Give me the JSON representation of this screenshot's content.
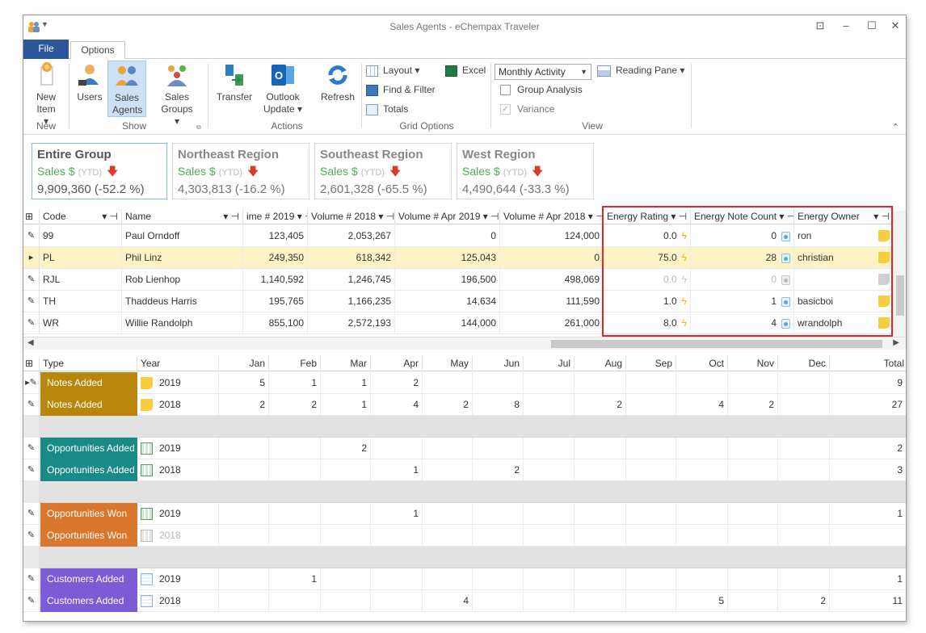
{
  "window": {
    "title": "Sales Agents - eChempax Traveler",
    "controls": [
      "⊡",
      "–",
      "☐",
      "✕"
    ]
  },
  "tabs": {
    "file": "File",
    "options": "Options"
  },
  "ribbon": {
    "new_item": "New Item ▾",
    "new_group": "New",
    "users": "Users",
    "sales_agents": "Sales Agents",
    "sales_groups": "Sales Groups ▾",
    "show_group": "Show",
    "transfer": "Transfer",
    "outlook_update": "Outlook Update ▾",
    "refresh": "Refresh",
    "actions_group": "Actions",
    "layout": "Layout ▾",
    "excel": "Excel",
    "find_filter": "Find & Filter",
    "totals": "Totals",
    "grid_options_group": "Grid Options",
    "activity_dropdown": "Monthly Activity",
    "group_analysis": "Group Analysis",
    "variance": "Variance",
    "reading_pane": "Reading Pane ▾",
    "view_group": "View"
  },
  "kpis": [
    {
      "title": "Entire Group",
      "metric": "Sales $",
      "ytd": "(YTD)",
      "value": "9,909,360 (-52.2 %)"
    },
    {
      "title": "Northeast Region",
      "metric": "Sales $",
      "ytd": "(YTD)",
      "value": "4,303,813 (-16.2 %)"
    },
    {
      "title": "Southeast Region",
      "metric": "Sales $",
      "ytd": "(YTD)",
      "value": "2,601,328 (-65.5 %)"
    },
    {
      "title": "West Region",
      "metric": "Sales $",
      "ytd": "(YTD)",
      "value": "4,490,644 (-33.3 %)"
    }
  ],
  "agents_grid": {
    "headers": {
      "code": "Code",
      "name": "Name",
      "vol_2019": "ime # 2019 ▾ ⊣",
      "vol_2018": "Volume # 2018 ▾ ⊣",
      "vol_apr_2019": "Volume # Apr 2019 ▾ ⊣",
      "vol_apr_2018": "Volume # Apr 2018 ▾ ⊣",
      "energy_rating": "Energy Rating ▾ ⊣",
      "energy_note_count": "Energy Note Count ▾ ⊣",
      "energy_owner": "Energy Owner"
    },
    "rows": [
      {
        "indicator": "✎",
        "code": "99",
        "name": "Paul Orndoff",
        "vol_2019": "123,405",
        "vol_2018": "2,053,267",
        "vol_apr_2019": "0",
        "vol_apr_2018": "124,000",
        "energy_rating": "0.0",
        "note_count": "0",
        "owner": "ron"
      },
      {
        "indicator": "▸",
        "code": "PL",
        "name": "Phil Linz",
        "vol_2019": "249,350",
        "vol_2018": "618,342",
        "vol_apr_2019": "125,043",
        "vol_apr_2018": "0",
        "energy_rating": "75.0",
        "note_count": "28",
        "owner": "christian"
      },
      {
        "indicator": "✎",
        "code": "RJL",
        "name": "Rob Lienhop",
        "vol_2019": "1,140,592",
        "vol_2018": "1,246,745",
        "vol_apr_2019": "196,500",
        "vol_apr_2018": "498,069",
        "energy_rating": "0.0",
        "note_count": "0",
        "owner": ""
      },
      {
        "indicator": "✎",
        "code": "TH",
        "name": "Thaddeus Harris",
        "vol_2019": "195,765",
        "vol_2018": "1,166,235",
        "vol_apr_2019": "14,634",
        "vol_apr_2018": "111,590",
        "energy_rating": "1.0",
        "note_count": "1",
        "owner": "basicboi"
      },
      {
        "indicator": "✎",
        "code": "WR",
        "name": "Willie Randolph",
        "vol_2019": "855,100",
        "vol_2018": "2,572,193",
        "vol_apr_2019": "144,000",
        "vol_apr_2018": "261,000",
        "energy_rating": "8.0",
        "note_count": "4",
        "owner": "wrandolph"
      }
    ]
  },
  "activity_grid": {
    "headers": {
      "type": "Type",
      "year": "Year",
      "months": [
        "Jan",
        "Feb",
        "Mar",
        "Apr",
        "May",
        "Jun",
        "Jul",
        "Aug",
        "Sep",
        "Oct",
        "Nov",
        "Dec"
      ],
      "total": "Total"
    },
    "groups": [
      {
        "type": "Notes Added",
        "color": "#b8860b",
        "rows": [
          {
            "year": "2019",
            "months": [
              "5",
              "1",
              "1",
              "2",
              "",
              "",
              "",
              "",
              "",
              "",
              "",
              ""
            ],
            "total": "9"
          },
          {
            "year": "2018",
            "months": [
              "2",
              "2",
              "1",
              "4",
              "2",
              "8",
              "",
              "2",
              "",
              "4",
              "2",
              ""
            ],
            "total": "27"
          }
        ]
      },
      {
        "type": "Opportunities Added",
        "color": "#1a8a88",
        "rows": [
          {
            "year": "2019",
            "months": [
              "",
              "",
              "2",
              "",
              "",
              "",
              "",
              "",
              "",
              "",
              "",
              ""
            ],
            "total": "2"
          },
          {
            "year": "2018",
            "months": [
              "",
              "",
              "",
              "1",
              "",
              "2",
              "",
              "",
              "",
              "",
              "",
              ""
            ],
            "total": "3"
          }
        ]
      },
      {
        "type": "Opportunities Won",
        "color": "#d9782d",
        "rows": [
          {
            "year": "2019",
            "months": [
              "",
              "",
              "",
              "1",
              "",
              "",
              "",
              "",
              "",
              "",
              "",
              ""
            ],
            "total": "1"
          },
          {
            "year": "2018",
            "months": [
              "",
              "",
              "",
              "",
              "",
              "",
              "",
              "",
              "",
              "",
              "",
              ""
            ],
            "total": ""
          }
        ]
      },
      {
        "type": "Customers Added",
        "color": "#7b5bd6",
        "rows": [
          {
            "year": "2019",
            "months": [
              "",
              "1",
              "",
              "",
              "",
              "",
              "",
              "",
              "",
              "",
              "",
              ""
            ],
            "total": "1"
          },
          {
            "year": "2018",
            "months": [
              "",
              "",
              "",
              "",
              "4",
              "",
              "",
              "",
              "",
              "5",
              "",
              "2"
            ],
            "total": "11"
          }
        ]
      }
    ]
  }
}
